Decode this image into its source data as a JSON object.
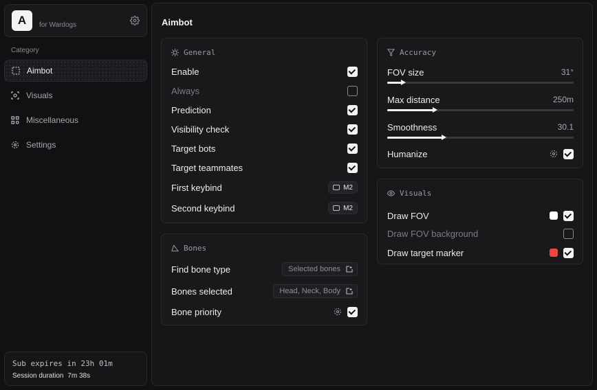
{
  "app": {
    "logo_letter": "A",
    "subtitle": "for Wardogs"
  },
  "sidebar": {
    "category_label": "Category",
    "items": [
      {
        "label": "Aimbot",
        "icon": "crosshair-icon",
        "active": true
      },
      {
        "label": "Visuals",
        "icon": "eye-scan-icon",
        "active": false
      },
      {
        "label": "Miscellaneous",
        "icon": "grid-icon",
        "active": false
      },
      {
        "label": "Settings",
        "icon": "gear-icon",
        "active": false
      }
    ],
    "footer": {
      "sub_expiry": "Sub expires in 23h 01m",
      "session_label": "Session duration",
      "session_value": "7m 38s"
    }
  },
  "main": {
    "title": "Aimbot",
    "general": {
      "heading": "General",
      "enable": {
        "label": "Enable",
        "checked": true
      },
      "always": {
        "label": "Always",
        "checked": false
      },
      "prediction": {
        "label": "Prediction",
        "checked": true
      },
      "visibility_check": {
        "label": "Visibility check",
        "checked": true
      },
      "target_bots": {
        "label": "Target bots",
        "checked": true
      },
      "target_teammates": {
        "label": "Target teammates",
        "checked": true
      },
      "first_keybind": {
        "label": "First keybind",
        "key": "M2"
      },
      "second_keybind": {
        "label": "Second keybind",
        "key": "M2"
      }
    },
    "bones": {
      "heading": "Bones",
      "find_bone_type": {
        "label": "Find bone type",
        "value": "Selected bones"
      },
      "bones_selected": {
        "label": "Bones selected",
        "value": "Head, Neck, Body"
      },
      "bone_priority": {
        "label": "Bone priority",
        "checked": true
      }
    },
    "accuracy": {
      "heading": "Accuracy",
      "fov_size": {
        "label": "FOV size",
        "value": "31°",
        "fill_percent": 8
      },
      "max_distance": {
        "label": "Max distance",
        "value": "250m",
        "fill_percent": 25
      },
      "smoothness": {
        "label": "Smoothness",
        "value": "30.1",
        "fill_percent": 30
      },
      "humanize": {
        "label": "Humanize",
        "checked": true
      }
    },
    "visuals": {
      "heading": "Visuals",
      "draw_fov": {
        "label": "Draw FOV",
        "checked": true,
        "color": "#ffffff"
      },
      "draw_fov_background": {
        "label": "Draw FOV background",
        "checked": false
      },
      "draw_target_marker": {
        "label": "Draw target marker",
        "checked": true,
        "color": "#ef4444"
      }
    }
  }
}
